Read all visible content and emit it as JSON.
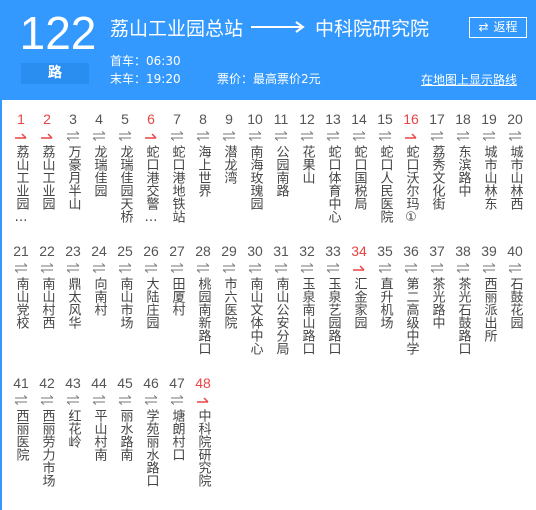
{
  "header": {
    "route_number": "122",
    "route_unit": "路",
    "origin": "荔山工业园总站",
    "destination": "中科院研究院",
    "reverse_button": "返程",
    "reverse_icon": "⇄",
    "first_bus": "首车：06:30",
    "last_bus": "末车：19:20",
    "fare": "票价：最高票价2元",
    "map_link": "在地图上显示路线",
    "colors": {
      "background": "#3399ff",
      "unit_box": "#2a8ef0",
      "highlight": "#e84444"
    }
  },
  "stops": [
    {
      "num": "1",
      "name": "荔山工业园…",
      "dir": "one-way",
      "red": true
    },
    {
      "num": "2",
      "name": "荔山工业园",
      "dir": "one-way",
      "red": true
    },
    {
      "num": "3",
      "name": "万豪月半山",
      "dir": "both",
      "red": false
    },
    {
      "num": "4",
      "name": "龙瑞佳园",
      "dir": "both",
      "red": false
    },
    {
      "num": "5",
      "name": "龙瑞佳园天桥",
      "dir": "both",
      "red": false
    },
    {
      "num": "6",
      "name": "蛇口港交警…",
      "dir": "one-way",
      "red": true
    },
    {
      "num": "7",
      "name": "蛇口港地铁站",
      "dir": "both",
      "red": false
    },
    {
      "num": "8",
      "name": "海上世界",
      "dir": "both",
      "red": false
    },
    {
      "num": "9",
      "name": "潜龙湾",
      "dir": "both",
      "red": false
    },
    {
      "num": "10",
      "name": "南海玫瑰园",
      "dir": "both",
      "red": false
    },
    {
      "num": "11",
      "name": "公园南路",
      "dir": "both",
      "red": false
    },
    {
      "num": "12",
      "name": "花果山",
      "dir": "both",
      "red": false
    },
    {
      "num": "13",
      "name": "蛇口体育中心",
      "dir": "both",
      "red": false
    },
    {
      "num": "14",
      "name": "蛇口国税局",
      "dir": "both",
      "red": false
    },
    {
      "num": "15",
      "name": "蛇口人民医院",
      "dir": "both",
      "red": false
    },
    {
      "num": "16",
      "name": "蛇口沃尔玛①",
      "dir": "one-way",
      "red": true
    },
    {
      "num": "17",
      "name": "荔秀文化街",
      "dir": "both",
      "red": false
    },
    {
      "num": "18",
      "name": "东滨路中",
      "dir": "both",
      "red": false
    },
    {
      "num": "19",
      "name": "城市山林东",
      "dir": "both",
      "red": false
    },
    {
      "num": "20",
      "name": "城市山林西",
      "dir": "both",
      "red": false
    },
    {
      "num": "21",
      "name": "南山党校",
      "dir": "both",
      "red": false
    },
    {
      "num": "22",
      "name": "南山村西",
      "dir": "both",
      "red": false
    },
    {
      "num": "23",
      "name": "鼎太风华",
      "dir": "both",
      "red": false
    },
    {
      "num": "24",
      "name": "向南村",
      "dir": "both",
      "red": false
    },
    {
      "num": "25",
      "name": "南山市场",
      "dir": "both",
      "red": false
    },
    {
      "num": "26",
      "name": "大陆庄园",
      "dir": "both",
      "red": false
    },
    {
      "num": "27",
      "name": "田厦村",
      "dir": "both",
      "red": false
    },
    {
      "num": "28",
      "name": "桃园南新路口",
      "dir": "both",
      "red": false
    },
    {
      "num": "29",
      "name": "市六医院",
      "dir": "both",
      "red": false
    },
    {
      "num": "30",
      "name": "南山文体中心",
      "dir": "both",
      "red": false
    },
    {
      "num": "31",
      "name": "南山公安分局",
      "dir": "both",
      "red": false
    },
    {
      "num": "32",
      "name": "玉泉南山路口",
      "dir": "both",
      "red": false
    },
    {
      "num": "33",
      "name": "玉泉艺园路口",
      "dir": "both",
      "red": false
    },
    {
      "num": "34",
      "name": "汇金家园",
      "dir": "one-way",
      "red": true
    },
    {
      "num": "35",
      "name": "直升机场",
      "dir": "both",
      "red": false
    },
    {
      "num": "36",
      "name": "第二高级中学",
      "dir": "both",
      "red": false
    },
    {
      "num": "37",
      "name": "茶光路中",
      "dir": "both",
      "red": false
    },
    {
      "num": "38",
      "name": "茶光石鼓路口",
      "dir": "both",
      "red": false
    },
    {
      "num": "39",
      "name": "西丽派出所",
      "dir": "both",
      "red": false
    },
    {
      "num": "40",
      "name": "石鼓花园",
      "dir": "both",
      "red": false
    },
    {
      "num": "41",
      "name": "西丽医院",
      "dir": "both",
      "red": false
    },
    {
      "num": "42",
      "name": "西丽劳力市场",
      "dir": "both",
      "red": false
    },
    {
      "num": "43",
      "name": "红花岭",
      "dir": "both",
      "red": false
    },
    {
      "num": "44",
      "name": "平山村南",
      "dir": "both",
      "red": false
    },
    {
      "num": "45",
      "name": "丽水路南",
      "dir": "both",
      "red": false
    },
    {
      "num": "46",
      "name": "学苑丽水路口",
      "dir": "both",
      "red": false
    },
    {
      "num": "47",
      "name": "塘朗村口",
      "dir": "both",
      "red": false
    },
    {
      "num": "48",
      "name": "中科院研究院",
      "dir": "one-way",
      "red": true
    }
  ]
}
